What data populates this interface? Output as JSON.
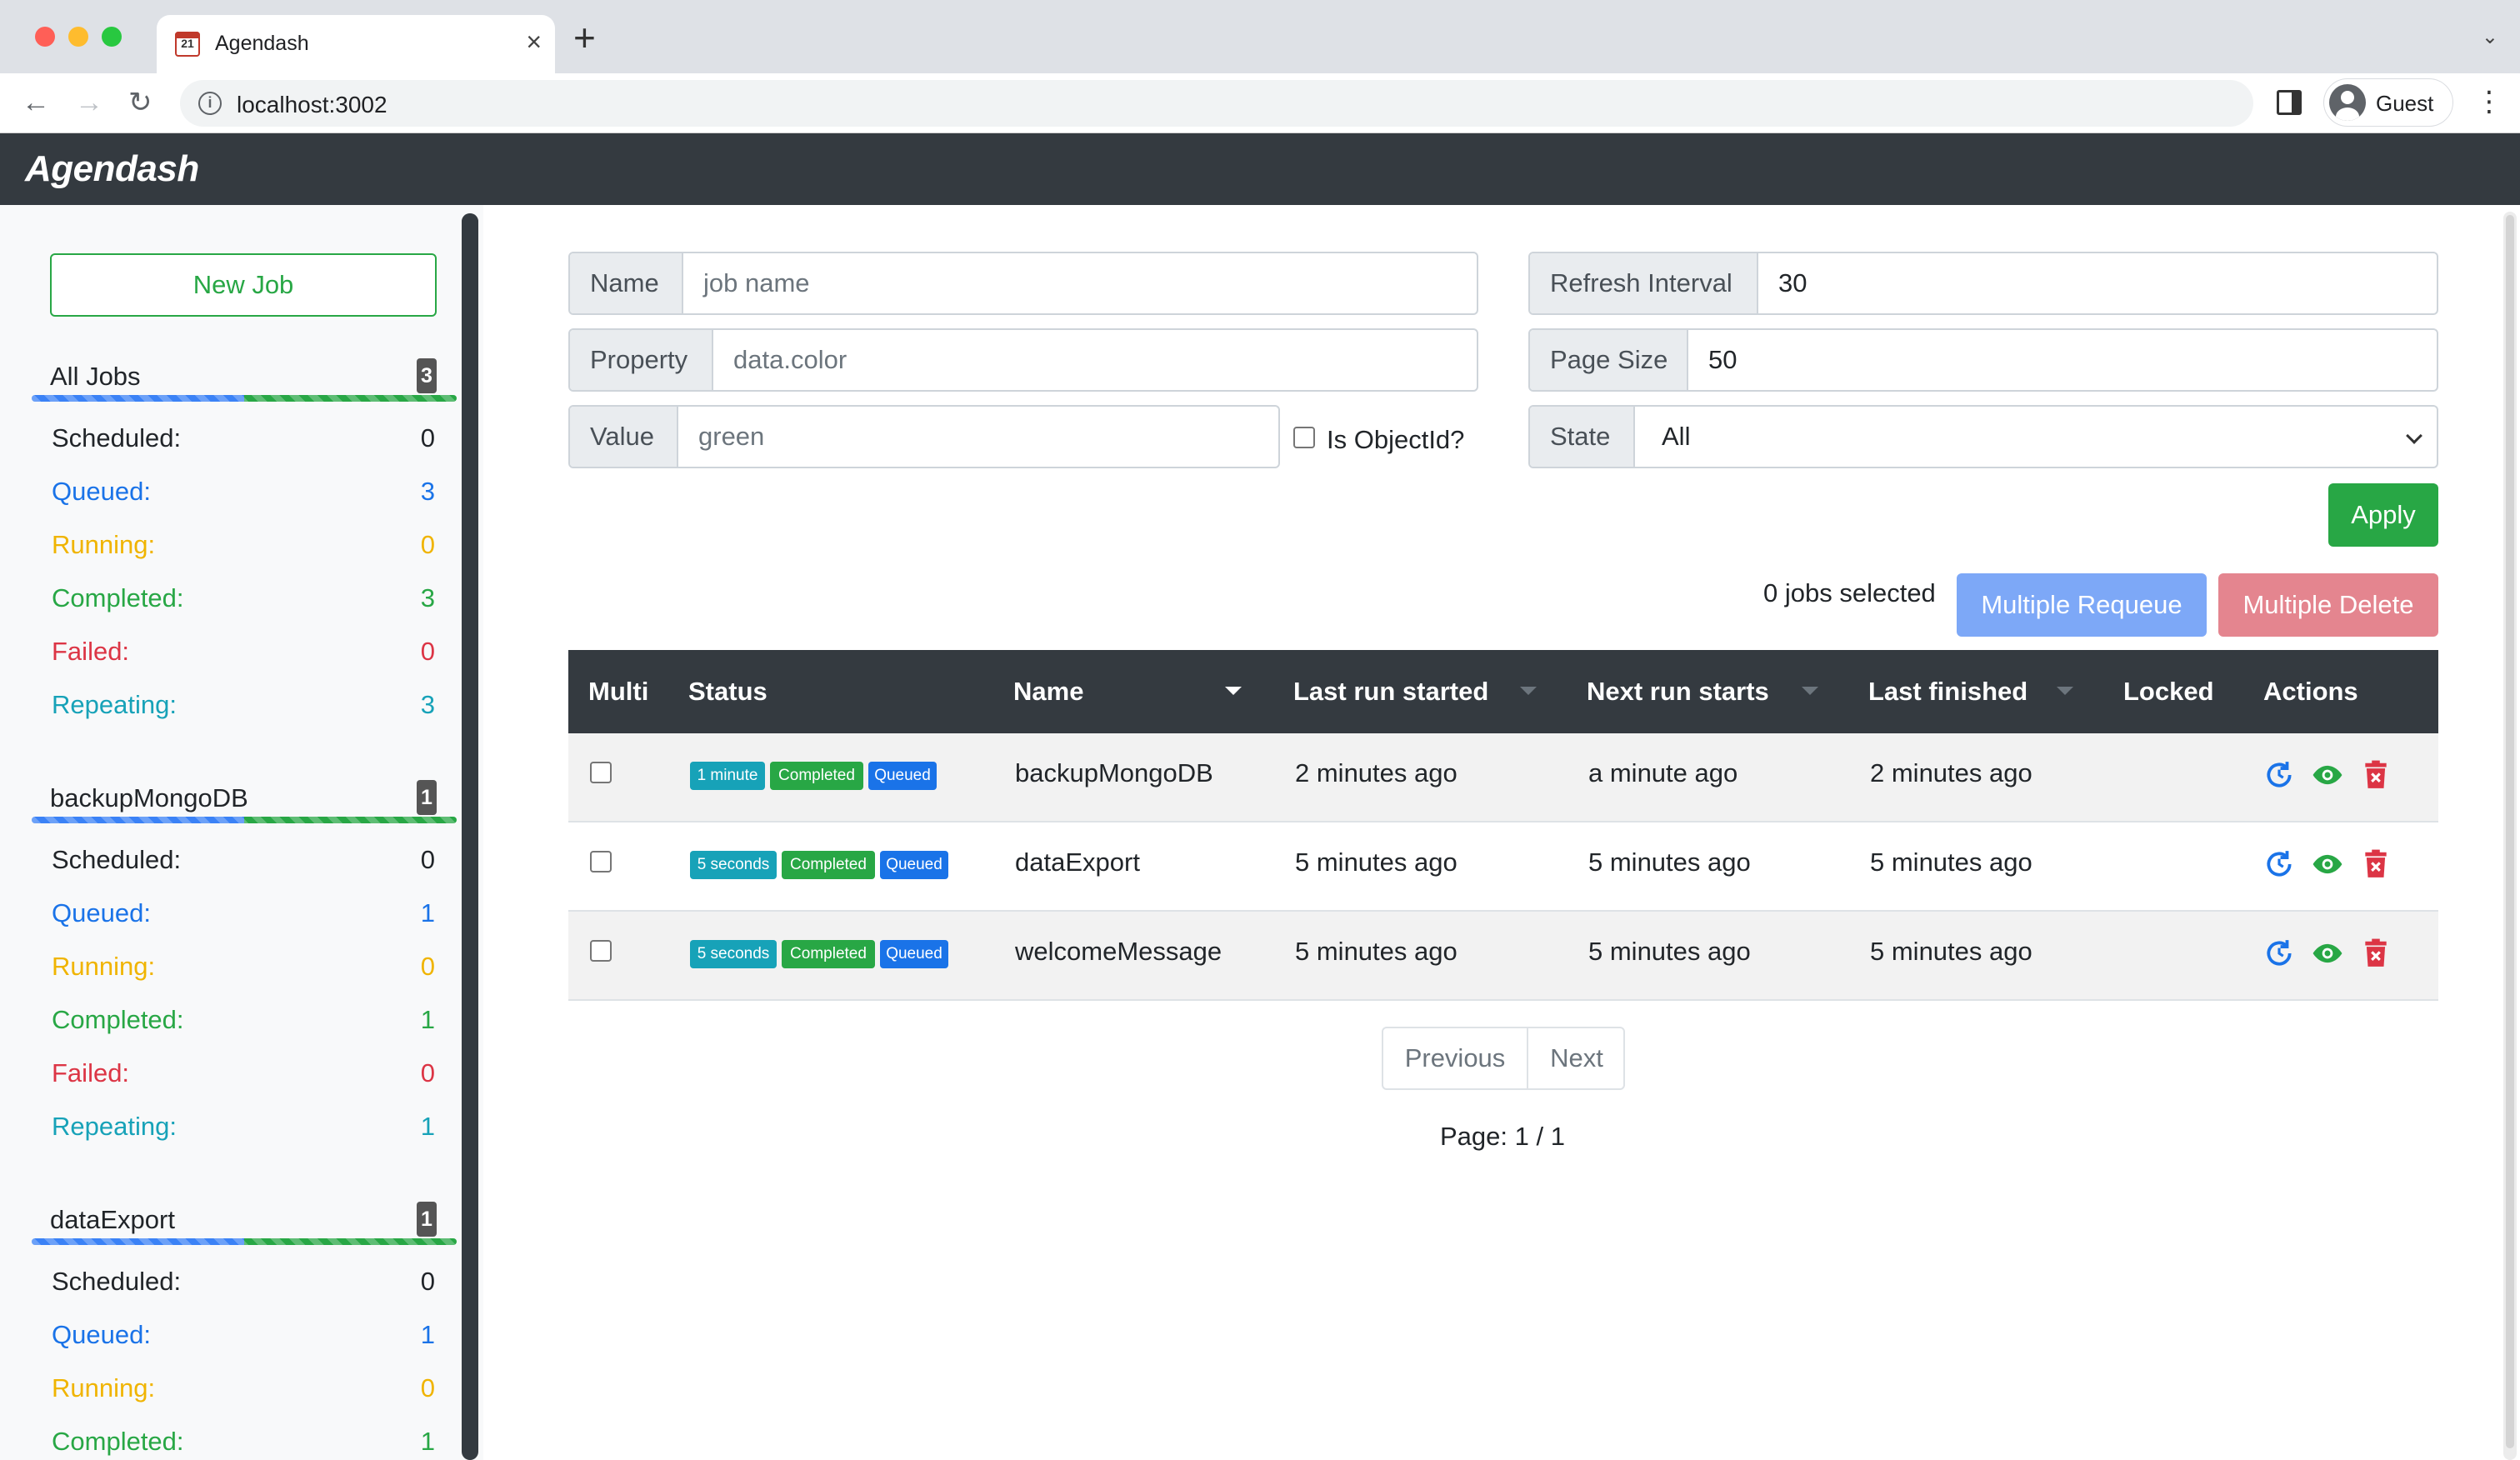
{
  "browser": {
    "tab_title": "Agendash",
    "url": "localhost:3002",
    "profile_label": "Guest"
  },
  "app": {
    "brand": "Agendash"
  },
  "sidebar": {
    "new_job_label": "New Job",
    "groups": [
      {
        "name": "All Jobs",
        "count": "3",
        "stats": {
          "scheduled": "0",
          "queued": "3",
          "running": "0",
          "completed": "3",
          "failed": "0",
          "repeating": "3"
        }
      },
      {
        "name": "backupMongoDB",
        "count": "1",
        "stats": {
          "scheduled": "0",
          "queued": "1",
          "running": "0",
          "completed": "1",
          "failed": "0",
          "repeating": "1"
        }
      },
      {
        "name": "dataExport",
        "count": "1",
        "stats": {
          "scheduled": "0",
          "queued": "1",
          "running": "0",
          "completed": "1"
        }
      }
    ],
    "stat_labels": {
      "scheduled": "Scheduled:",
      "queued": "Queued:",
      "running": "Running:",
      "completed": "Completed:",
      "failed": "Failed:",
      "repeating": "Repeating:"
    },
    "progress": {
      "queued_fraction": 0.5,
      "completed_fraction": 0.5
    }
  },
  "filters": {
    "name": {
      "label": "Name",
      "value": "",
      "placeholder": "job name"
    },
    "property": {
      "label": "Property",
      "value": "",
      "placeholder": "data.color"
    },
    "value": {
      "label": "Value",
      "value": "",
      "placeholder": "green"
    },
    "is_objectid": {
      "label": "Is ObjectId?",
      "checked": false
    },
    "refresh_interval": {
      "label": "Refresh Interval",
      "value": "30"
    },
    "page_size": {
      "label": "Page Size",
      "value": "50"
    },
    "state": {
      "label": "State",
      "selected": "All"
    },
    "apply_label": "Apply"
  },
  "bulk": {
    "selected_text": "0 jobs selected",
    "requeue_label": "Multiple Requeue",
    "delete_label": "Multiple Delete"
  },
  "table": {
    "columns": [
      "Multi",
      "Status",
      "Name",
      "Last run started",
      "Next run starts",
      "Last finished",
      "Locked",
      "Actions"
    ],
    "rows": [
      {
        "interval": "1 minute",
        "status_completed": "Completed",
        "status_queued": "Queued",
        "name": "backupMongoDB",
        "last_run_started": "2 minutes ago",
        "next_run_starts": "a minute ago",
        "last_finished": "2 minutes ago",
        "locked": ""
      },
      {
        "interval": "5 seconds",
        "status_completed": "Completed",
        "status_queued": "Queued",
        "name": "dataExport",
        "last_run_started": "5 minutes ago",
        "next_run_starts": "5 minutes ago",
        "last_finished": "5 minutes ago",
        "locked": ""
      },
      {
        "interval": "5 seconds",
        "status_completed": "Completed",
        "status_queued": "Queued",
        "name": "welcomeMessage",
        "last_run_started": "5 minutes ago",
        "next_run_starts": "5 minutes ago",
        "last_finished": "5 minutes ago",
        "locked": ""
      }
    ],
    "action_icons": [
      "requeue-icon",
      "view-icon",
      "delete-icon"
    ]
  },
  "pagination": {
    "previous_label": "Previous",
    "next_label": "Next",
    "page_text": "Page: 1 / 1"
  },
  "colors": {
    "navbar": "#343a40",
    "success": "#28a745",
    "primary": "#1a73e8",
    "warning": "#f0b400",
    "danger": "#dc3545",
    "info": "#17a2b8"
  }
}
